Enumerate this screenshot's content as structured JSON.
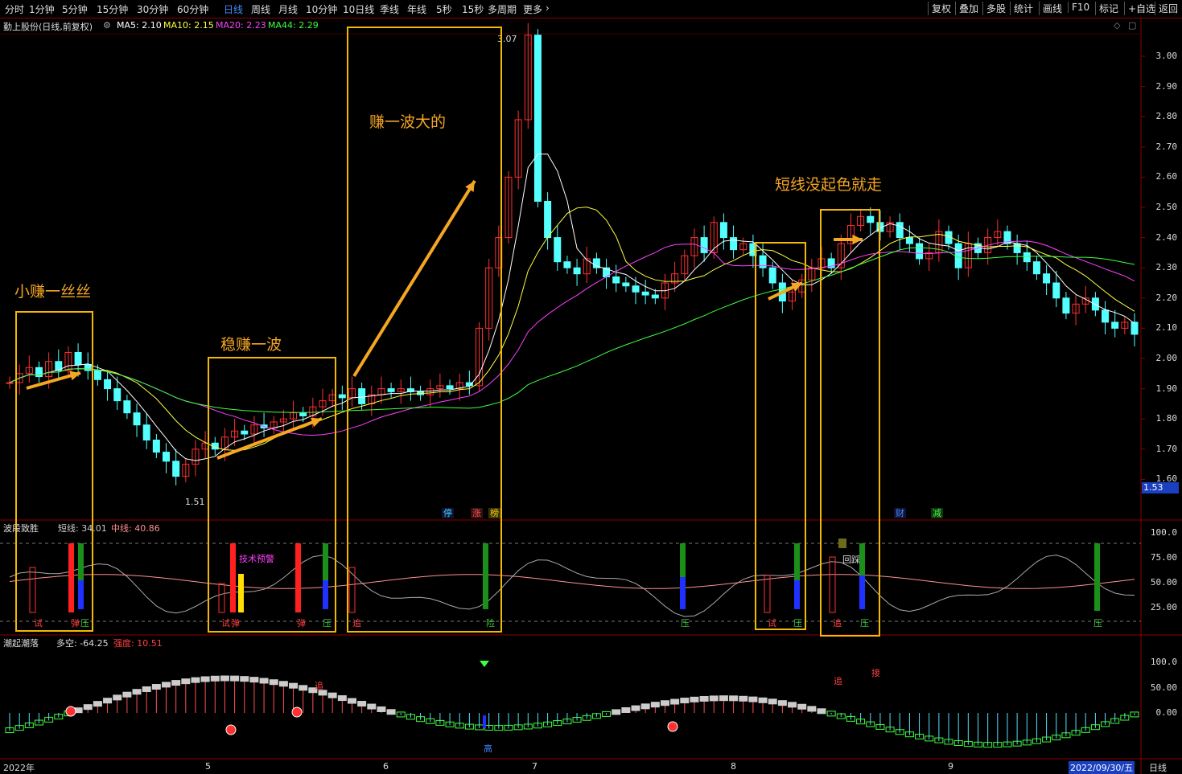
{
  "toolbar": {
    "periods": [
      "分时",
      "1分钟",
      "5分钟",
      "15分钟",
      "30分钟",
      "60分钟",
      "日线",
      "周线",
      "月线",
      "10分钟",
      "10日线",
      "季线",
      "年线",
      "5秒",
      "15秒",
      "多周期",
      "更多"
    ],
    "active": "日线",
    "right_buttons": [
      "复权",
      "叠加",
      "多股",
      "统计",
      "画线",
      "F10",
      "标记",
      "+自选",
      "返回"
    ]
  },
  "main_chart": {
    "title": "勤上股份(日线,前复权)",
    "ma": [
      {
        "label": "MA5: 2.10",
        "color": "#ffffff"
      },
      {
        "label": "MA10: 2.15",
        "color": "#ffff40"
      },
      {
        "label": "MA20: 2.23",
        "color": "#ff40ff"
      },
      {
        "label": "MA44: 2.29",
        "color": "#40ff40"
      }
    ],
    "high_label": "3.07",
    "low_label": "1.51",
    "current_price": "1.53",
    "y_ticks": [
      "3.00",
      "2.90",
      "2.80",
      "2.70",
      "2.60",
      "2.50",
      "2.40",
      "2.30",
      "2.20",
      "2.10",
      "2.00",
      "1.90",
      "1.80",
      "1.70",
      "1.60"
    ],
    "badges": [
      {
        "text": "停",
        "color": "#3fd7ff"
      },
      {
        "text": "涨",
        "color": "#ff5050"
      },
      {
        "text": "榜",
        "color": "#ffcc00"
      },
      {
        "text": "财",
        "color": "#3f8cff"
      },
      {
        "text": "减",
        "color": "#40ff40"
      }
    ],
    "annotations": [
      "小赚一丝丝",
      "稳赚一波",
      "赚一波大的",
      "短线没起色就走"
    ]
  },
  "indicator1": {
    "title": "波段致胜",
    "short_label": "短线: 34.01",
    "mid_label": "中线: 40.86",
    "y_ticks": [
      "100.0",
      "75.00",
      "50.00",
      "25.00"
    ],
    "tech_warning": "技术预警",
    "callback": "回踩",
    "signals": [
      "试",
      "弹",
      "压",
      "试",
      "弹",
      "弹",
      "压",
      "追",
      "险",
      "压",
      "试",
      "压",
      "追",
      "压",
      "压"
    ]
  },
  "indicator2": {
    "title": "潮起潮落",
    "bull_bear": "多空: -64.25",
    "strength": "强度: 10.51",
    "y_ticks": [
      "100.0",
      "50.00",
      "0.00"
    ],
    "signals": [
      "追",
      "高",
      "追",
      "接"
    ]
  },
  "x_axis": {
    "labels": [
      "2022年",
      "5",
      "6",
      "7",
      "8",
      "9"
    ],
    "current_date": "2022/09/30/五",
    "period": "日线"
  }
}
